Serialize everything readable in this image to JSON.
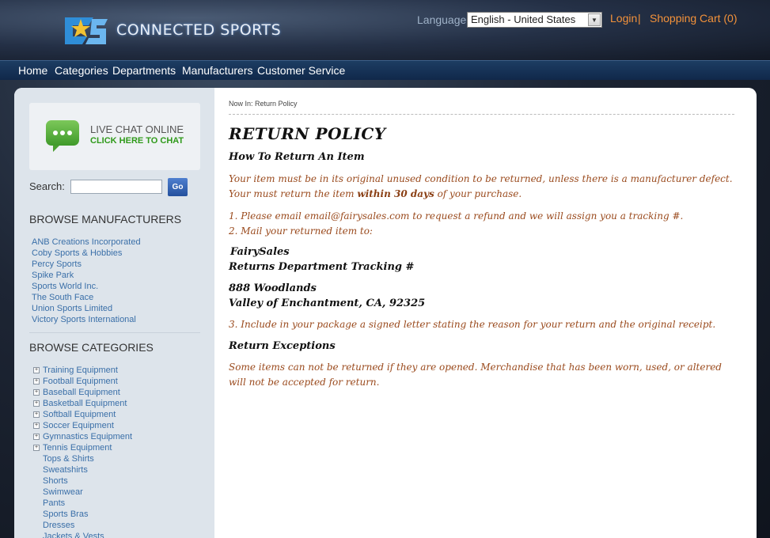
{
  "header": {
    "brand": "CONNECTED SPORTS",
    "language_label": "Language:",
    "language_value": "English - United States",
    "login": "Login",
    "separator": "|",
    "cart": "Shopping Cart (0)"
  },
  "nav": {
    "items": [
      "Home",
      "Categories",
      "Departments",
      "Manufacturers",
      "Customer Service"
    ]
  },
  "sidebar": {
    "chat_line1": "LIVE CHAT ONLINE",
    "chat_line2": "CLICK HERE TO CHAT",
    "search_label": "Search:",
    "search_value": "",
    "go_label": "Go",
    "manufacturers_heading": "BROWSE MANUFACTURERS",
    "manufacturers": [
      "ANB Creations Incorporated",
      "Coby Sports & Hobbies",
      "Percy Sports",
      "Spike Park",
      "Sports World Inc.",
      "The South Face",
      "Union Sports Limited",
      "Victory Sports International"
    ],
    "categories_heading": "BROWSE CATEGORIES",
    "categories": [
      "Training Equipment",
      "Football Equipment",
      "Baseball Equipment",
      "Basketball Equipment",
      "Softball Equipment",
      "Soccer Equipment",
      "Gymnastics Equipment",
      "Tennis Equipment"
    ],
    "subcategories": [
      "Tops & Shirts",
      "Sweatshirts",
      "Shorts",
      "Swimwear",
      "Pants",
      "Sports Bras",
      "Dresses",
      "Jackets & Vests"
    ]
  },
  "main": {
    "breadcrumb": "Now In: Return Policy",
    "title": "RETURN POLICY",
    "how_heading": "How To Return An Item",
    "para1_pre": "Your item must be in its original unused condition to be returned, unless there is a manufacturer defect. Your must return the item ",
    "para1_bold": "within 30 days",
    "para1_post": " of your purchase.",
    "step1": "1. Please email email@fairysales.com to request a refund and we will assign you a tracking #.",
    "step2": "2. Mail your returned item to:",
    "addr1": "FairySales",
    "addr2": "Returns Department Tracking #",
    "addr3": "888 Woodlands",
    "addr4": "Valley of Enchantment, CA, 92325",
    "step3": "3. Include in your package a signed letter stating the reason for your return and the original receipt.",
    "exceptions_heading": "Return Exceptions",
    "exceptions_text": "Some items can not be returned if they are opened.  Merchandise that has been worn, used, or altered will not be accepted for return."
  }
}
